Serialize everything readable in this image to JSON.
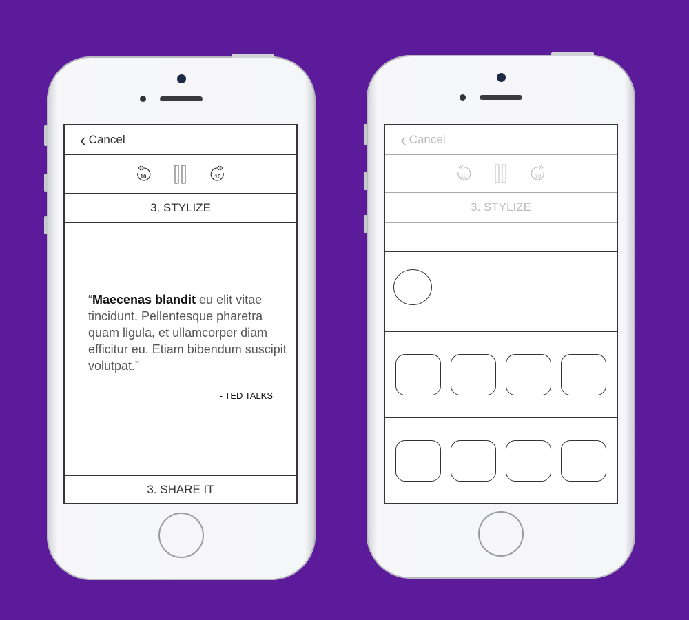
{
  "left_phone": {
    "cancel_label": "Cancel",
    "replay_label": "10",
    "forward_label": "10",
    "section_title": "3. STYLIZE",
    "quote_bold": "Maecenas blandit",
    "quote_rest": " eu elit vitae tincidunt. Pellentesque pharetra quam ligula, et ullamcorper diam efficitur eu. Etiam bibendum suscipit volutpat.”",
    "quote_open": "“",
    "attribution": "- TED TALKS",
    "share_label": "3. SHARE IT"
  },
  "right_phone": {
    "cancel_label": "Cancel",
    "replay_label": "10",
    "forward_label": "10",
    "section_title": "3. STYLIZE"
  },
  "colors": {
    "background": "#5c1b9b"
  }
}
